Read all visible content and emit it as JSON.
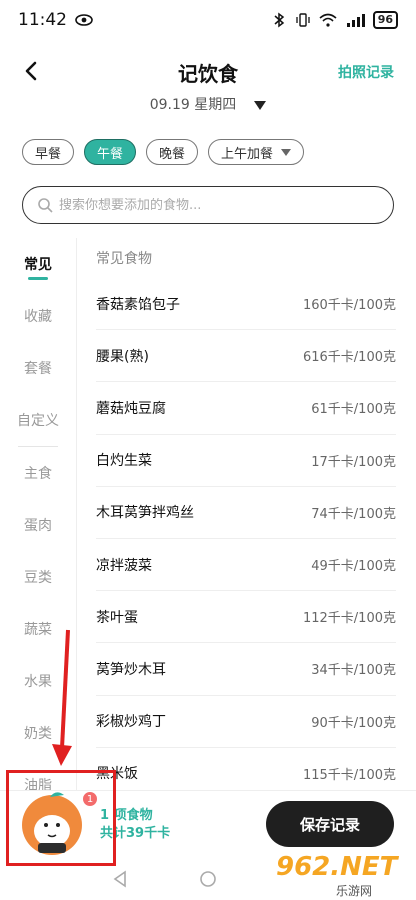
{
  "status_bar": {
    "time": "11:42",
    "battery": "96"
  },
  "header": {
    "title": "记饮食",
    "photo_record": "拍照记录",
    "date": "09.19 星期四"
  },
  "meal_tabs": [
    {
      "label": "早餐"
    },
    {
      "label": "午餐"
    },
    {
      "label": "晚餐"
    },
    {
      "label": "上午加餐"
    }
  ],
  "active_meal": "午餐",
  "search": {
    "placeholder": "搜索你想要添加的食物..."
  },
  "categories": [
    {
      "label": "常见"
    },
    {
      "label": "收藏"
    },
    {
      "label": "套餐"
    },
    {
      "label": "自定义"
    },
    {
      "label": "主食"
    },
    {
      "label": "蛋肉"
    },
    {
      "label": "豆类"
    },
    {
      "label": "蔬菜"
    },
    {
      "label": "水果"
    },
    {
      "label": "奶类"
    },
    {
      "label": "油脂"
    }
  ],
  "food_section": {
    "title": "常见食物"
  },
  "foods": [
    {
      "name": "香菇素馅包子",
      "calories": "160千卡/100克"
    },
    {
      "name": "腰果(熟)",
      "calories": "616千卡/100克"
    },
    {
      "name": "蘑菇炖豆腐",
      "calories": "61千卡/100克"
    },
    {
      "name": "白灼生菜",
      "calories": "17千卡/100克"
    },
    {
      "name": "木耳莴笋拌鸡丝",
      "calories": "74千卡/100克"
    },
    {
      "name": "凉拌菠菜",
      "calories": "49千卡/100克"
    },
    {
      "name": "茶叶蛋",
      "calories": "112千卡/100克"
    },
    {
      "name": "莴笋炒木耳",
      "calories": "34千卡/100克"
    },
    {
      "name": "彩椒炒鸡丁",
      "calories": "90千卡/100克"
    },
    {
      "name": "黑米饭",
      "calories": "115千卡/100克"
    }
  ],
  "bottom": {
    "badge": "1",
    "count_text": "1 项食物",
    "total_text": "共计39千卡",
    "save_label": "保存记录"
  },
  "watermark": {
    "main": "962.NET",
    "sub": "乐游网"
  },
  "colors": {
    "accent": "#2fb3a0",
    "annotation": "#e02020",
    "save_button": "#1f1f1f"
  }
}
